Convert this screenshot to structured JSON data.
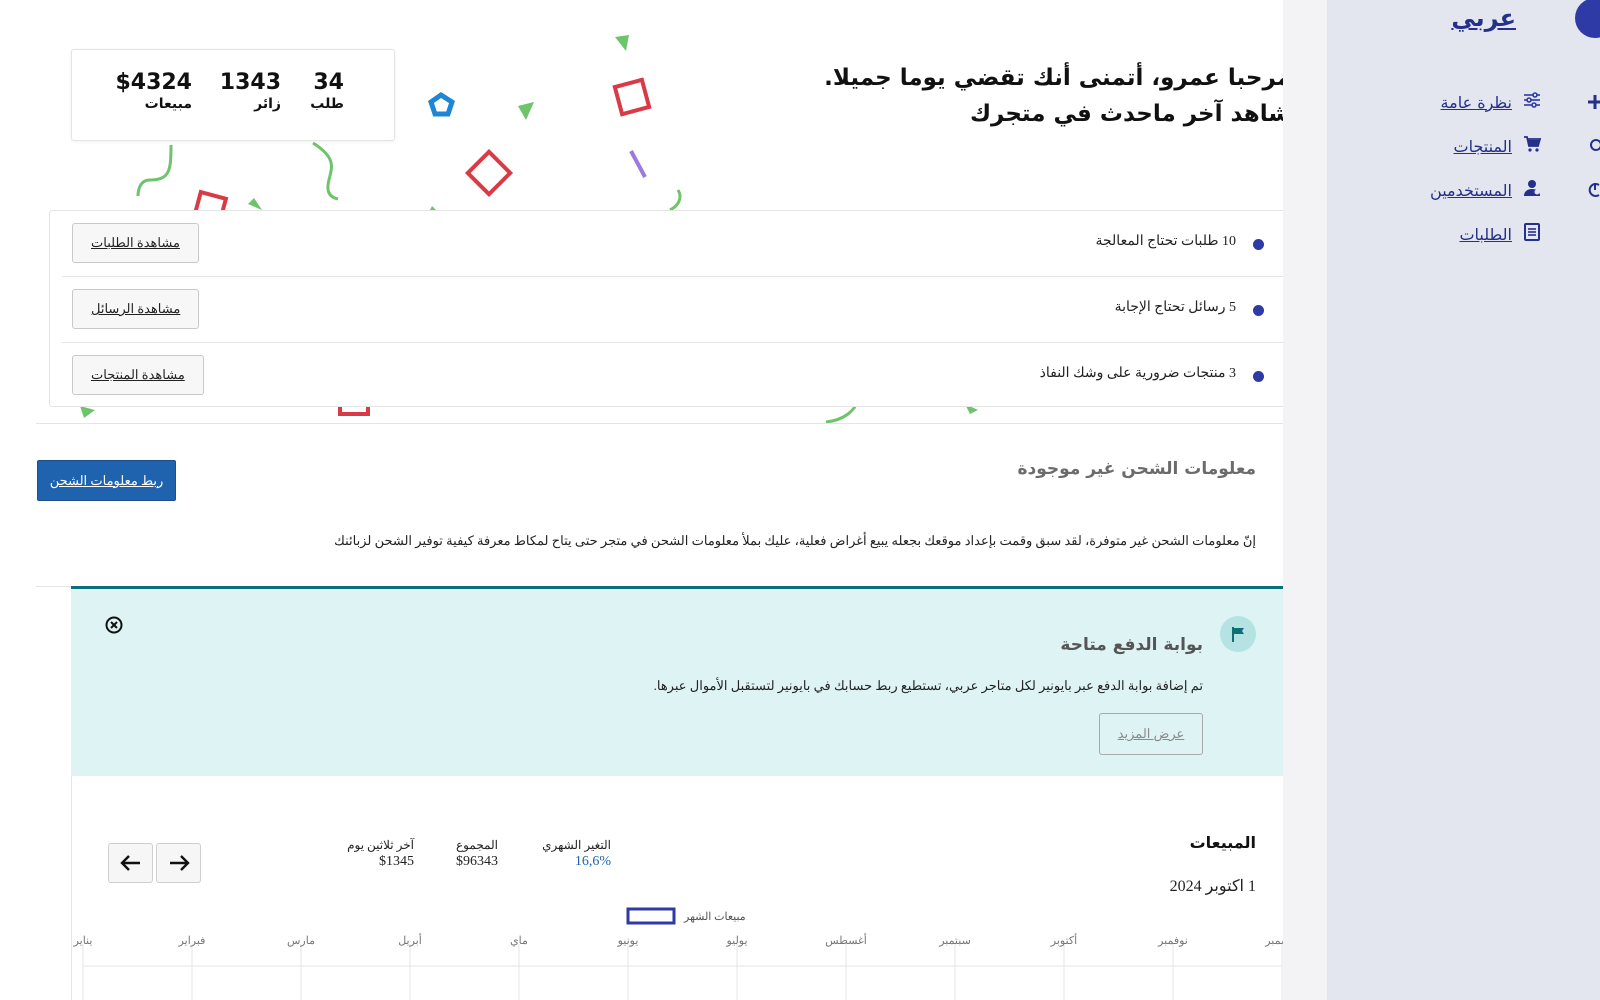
{
  "sidebar": {
    "brand": "عربي",
    "items": [
      {
        "label": "نظرة عامة",
        "icon": "sliders-icon"
      },
      {
        "label": "المنتجات",
        "icon": "cart-icon"
      },
      {
        "label": "المستخدمين",
        "icon": "user-icon"
      },
      {
        "label": "الطلبات",
        "icon": "document-icon"
      }
    ]
  },
  "greeting": {
    "line1": "مرحبا عمرو، أتمنى أنك تقضي يوما جميلا.",
    "line2": "شاهد آخر ماحدث في متجرك"
  },
  "stats": [
    {
      "value": "34",
      "caption": "طلب"
    },
    {
      "value": "1343",
      "caption": "زائر"
    },
    {
      "value": "$4324",
      "caption": "مبيعات"
    }
  ],
  "todos": [
    {
      "text": "10 طلبات تحتاج المعالجة",
      "button": "مشاهدة الطلبات"
    },
    {
      "text": "5 رسائل تحتاج الإجابة",
      "button": "مشاهدة الرسائل"
    },
    {
      "text": "3 منتجات ضرورية على وشك النفاذ",
      "button": "مشاهدة المنتجات"
    }
  ],
  "shipping": {
    "title": "معلومات الشحن غير موجودة",
    "description": "إنّ معلومات الشحن غير متوفرة، لقد سبق وقمت بإعداد موقعك بجعله يبيع أغراض فعلية، عليك بملأ معلومات الشحن في متجر حتى يتاح لمكاط معرفة كيفية توفير الشحن لزبائنك",
    "button": "ربط معلومات الشحن"
  },
  "notice": {
    "title": "بوابة الدفع متاحة",
    "text": "تم إضافة بوابة الدفع عبر بايونير لكل متاجر عربي، تستطيع ربط حسابك في بايونير لتستقبل الأموال عبرها.",
    "button": "عرض المزيد"
  },
  "sales": {
    "title": "المبيعات",
    "date": "1 اكتوبر 2024",
    "metrics": [
      {
        "label": "التغير الشهري",
        "value": "16,6%"
      },
      {
        "label": "المجموع",
        "value": "$96343"
      },
      {
        "label": "آخر ثلاثين يوم",
        "value": "$1345"
      }
    ]
  },
  "colors": {
    "brand": "#2e3aa5",
    "link": "#24308a",
    "primary_button": "#1f63ae",
    "notice_bg": "#def3f3",
    "notice_border": "#0d7077"
  },
  "chart_data": {
    "type": "line",
    "title": "",
    "legend": [
      "مبيعات الشهر"
    ],
    "legend_placement": "top-center",
    "categories": [
      "يناير",
      "فبراير",
      "مارس",
      "أبريل",
      "ماي",
      "يونيو",
      "يوليو",
      "أغسطس",
      "سبتمبر",
      "أكتوبر",
      "نوفمبر",
      "ديسمبر"
    ],
    "series": [
      {
        "name": "مبيعات الشهر",
        "values": []
      }
    ],
    "grid": true,
    "legend_color": "#2e3aa5"
  }
}
